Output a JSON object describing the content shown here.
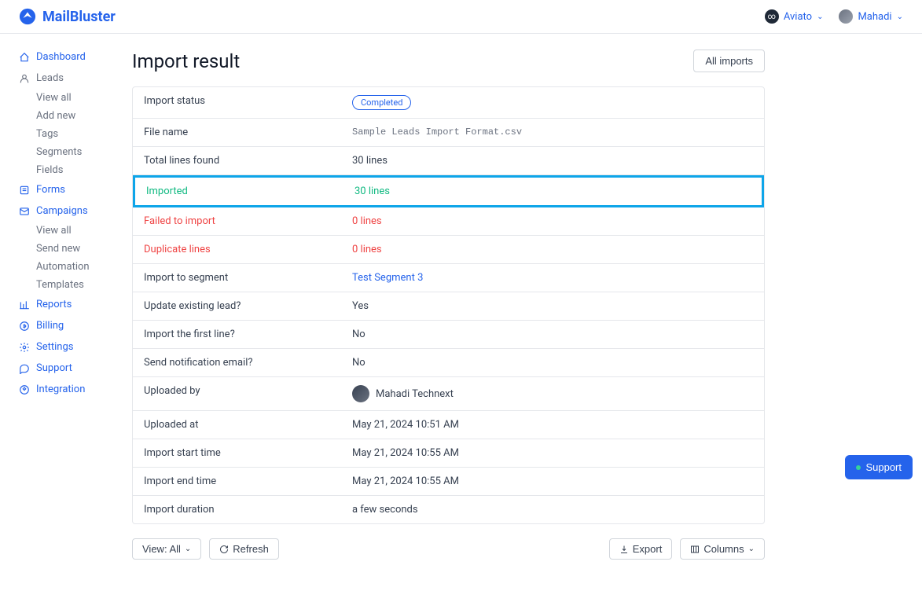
{
  "header": {
    "logo_text": "MailBluster",
    "workspace": "Aviato",
    "user": "Mahadi"
  },
  "sidebar": {
    "dashboard": "Dashboard",
    "leads": "Leads",
    "leads_items": [
      "View all",
      "Add new",
      "Tags",
      "Segments",
      "Fields"
    ],
    "forms": "Forms",
    "campaigns": "Campaigns",
    "campaigns_items": [
      "View all",
      "Send new",
      "Automation",
      "Templates"
    ],
    "reports": "Reports",
    "billing": "Billing",
    "settings": "Settings",
    "support": "Support",
    "integration": "Integration"
  },
  "page": {
    "title": "Import result",
    "all_imports": "All imports"
  },
  "rows": {
    "import_status_label": "Import status",
    "import_status_value": "Completed",
    "file_name_label": "File name",
    "file_name_value": "Sample Leads Import Format.csv",
    "total_lines_label": "Total lines found",
    "total_lines_value": "30 lines",
    "imported_label": "Imported",
    "imported_value": "30 lines",
    "failed_label": "Failed to import",
    "failed_value": "0 lines",
    "duplicate_label": "Duplicate lines",
    "duplicate_value": "0 lines",
    "segment_label": "Import to segment",
    "segment_value": "Test Segment 3",
    "update_label": "Update existing lead?",
    "update_value": "Yes",
    "first_line_label": "Import the first line?",
    "first_line_value": "No",
    "email_label": "Send notification email?",
    "email_value": "No",
    "uploaded_by_label": "Uploaded by",
    "uploaded_by_value": "Mahadi Technext",
    "uploaded_at_label": "Uploaded at",
    "uploaded_at_value": "May 21, 2024 10:51 AM",
    "start_label": "Import start time",
    "start_value": "May 21, 2024 10:55 AM",
    "end_label": "Import end time",
    "end_value": "May 21, 2024 10:55 AM",
    "duration_label": "Import duration",
    "duration_value": "a few seconds"
  },
  "bottom": {
    "view": "View: All",
    "refresh": "Refresh",
    "export": "Export",
    "columns": "Columns"
  },
  "support_btn": "Support"
}
